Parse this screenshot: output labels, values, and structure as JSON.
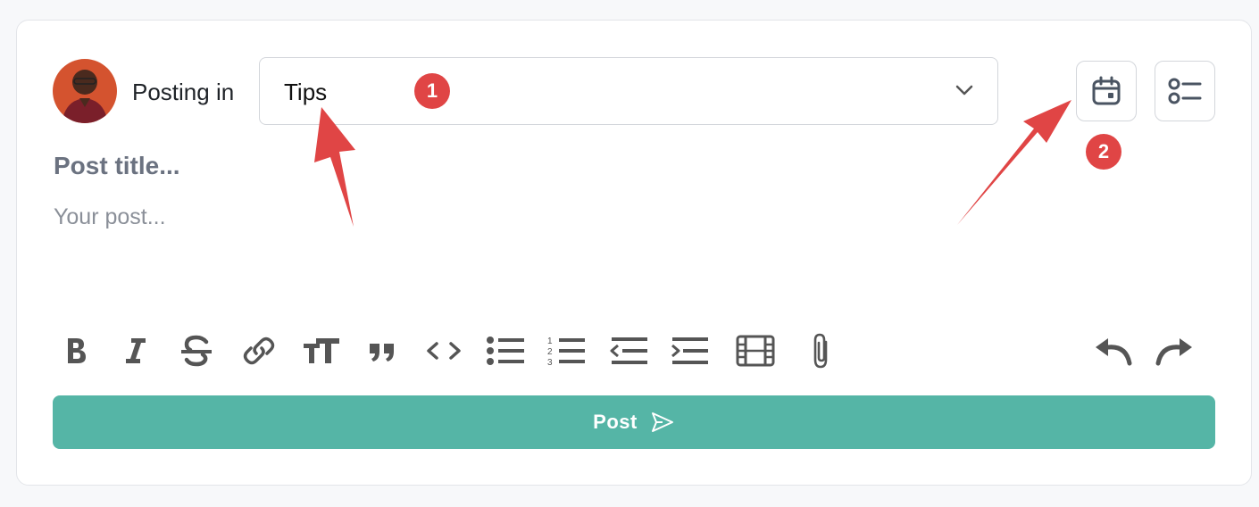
{
  "composer": {
    "posting_in_label": "Posting in",
    "space_select": {
      "value": "Tips"
    },
    "title_placeholder": "Post title...",
    "body_placeholder": "Your post...",
    "post_button_label": "Post"
  },
  "header_actions": [
    {
      "name": "schedule-post",
      "icon": "calendar-icon"
    },
    {
      "name": "post-settings",
      "icon": "checklist-icon"
    }
  ],
  "toolbar": {
    "formatting": [
      "bold-icon",
      "italic-icon",
      "strikethrough-icon",
      "link-icon",
      "text-size-icon",
      "quote-icon",
      "code-icon",
      "bullet-list-icon",
      "numbered-list-icon",
      "outdent-icon",
      "indent-icon",
      "video-icon",
      "attachment-icon"
    ],
    "history": [
      "undo-icon",
      "redo-icon"
    ]
  },
  "annotations": [
    {
      "number": "1",
      "color": "#e04545"
    },
    {
      "number": "2",
      "color": "#e04545"
    }
  ],
  "colors": {
    "accent": "#55b5a6",
    "annotation": "#e04545",
    "border": "#d3d6db"
  }
}
